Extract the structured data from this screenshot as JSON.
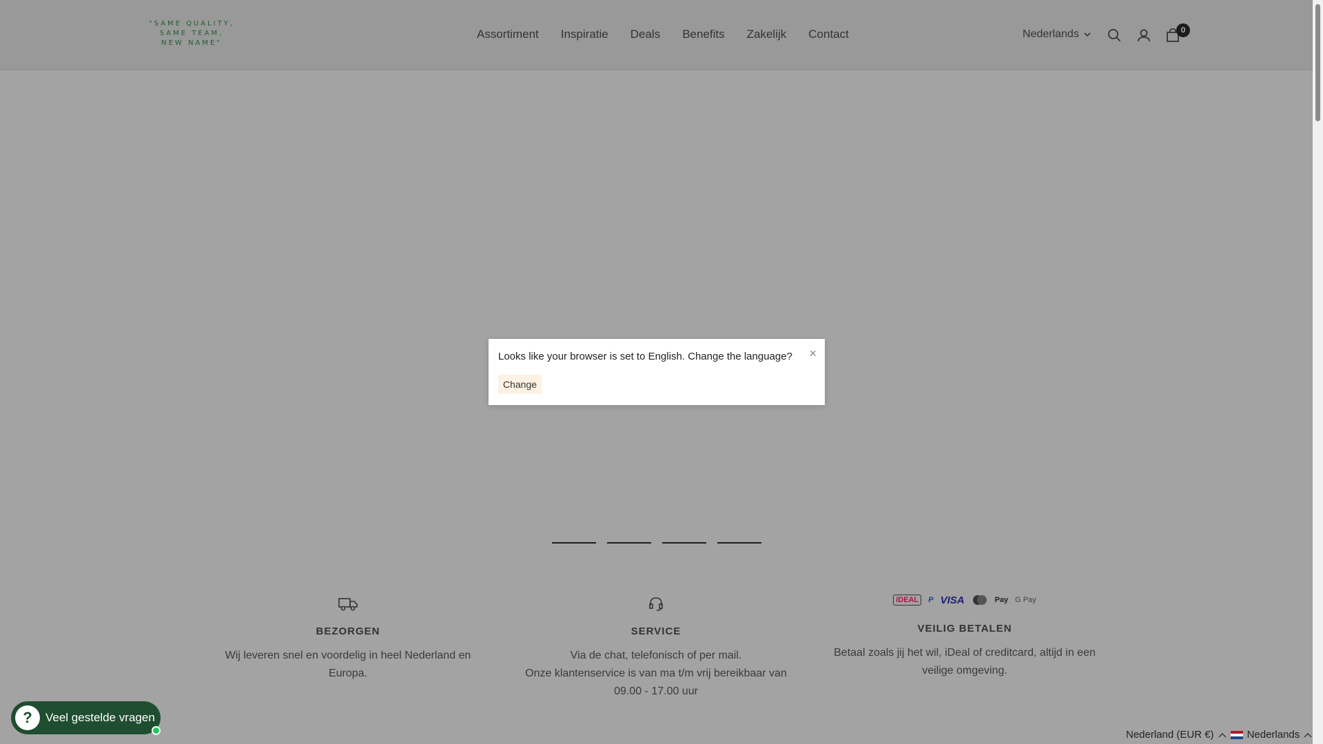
{
  "header": {
    "logo_lines": [
      "\"SAME QUALITY,",
      "SAME TEAM,",
      "NEW NAME\""
    ],
    "nav": [
      "Assortiment",
      "Inspiratie",
      "Deals",
      "Benefits",
      "Zakelijk",
      "Contact"
    ],
    "language": "Nederlands",
    "cart_count": "0",
    "icons": [
      "search-icon",
      "account-icon",
      "cart-icon"
    ]
  },
  "modal": {
    "message": "Looks like your browser is set to English. Change the language?",
    "button_label": "Change",
    "close_symbol": "×"
  },
  "features": [
    {
      "icon": "truck-icon",
      "title": "BEZORGEN",
      "lines": [
        "Wij leveren snel en voordelig in heel Nederland en",
        "Europa."
      ]
    },
    {
      "icon": "headset-icon",
      "title": "SERVICE",
      "lines": [
        "Via de chat, telefonisch of per mail.",
        "Onze klantenservice is van ma t/m vrij bereikbaar van",
        "09.00 - 17.00 uur"
      ]
    },
    {
      "icon": "payment-icons",
      "title": "VEILIG BETALEN",
      "payments": [
        "iDEAL",
        "PayPal",
        "VISA",
        "Mastercard",
        "Apple Pay",
        "G Pay"
      ],
      "lines": [
        "Betaal zoals jij het wil, iDeal of creditcard, altijd in een",
        "veilige omgeving."
      ]
    }
  ],
  "faq": {
    "label": "Veel gestelde vragen",
    "icon": "?"
  },
  "locale": {
    "country": "Nederland (EUR €)",
    "language": "Nederlands"
  },
  "colors": {
    "brand_green": "#1f4d30",
    "overlay": "#a3a3a3",
    "button_bg": "#fdf2e3"
  }
}
